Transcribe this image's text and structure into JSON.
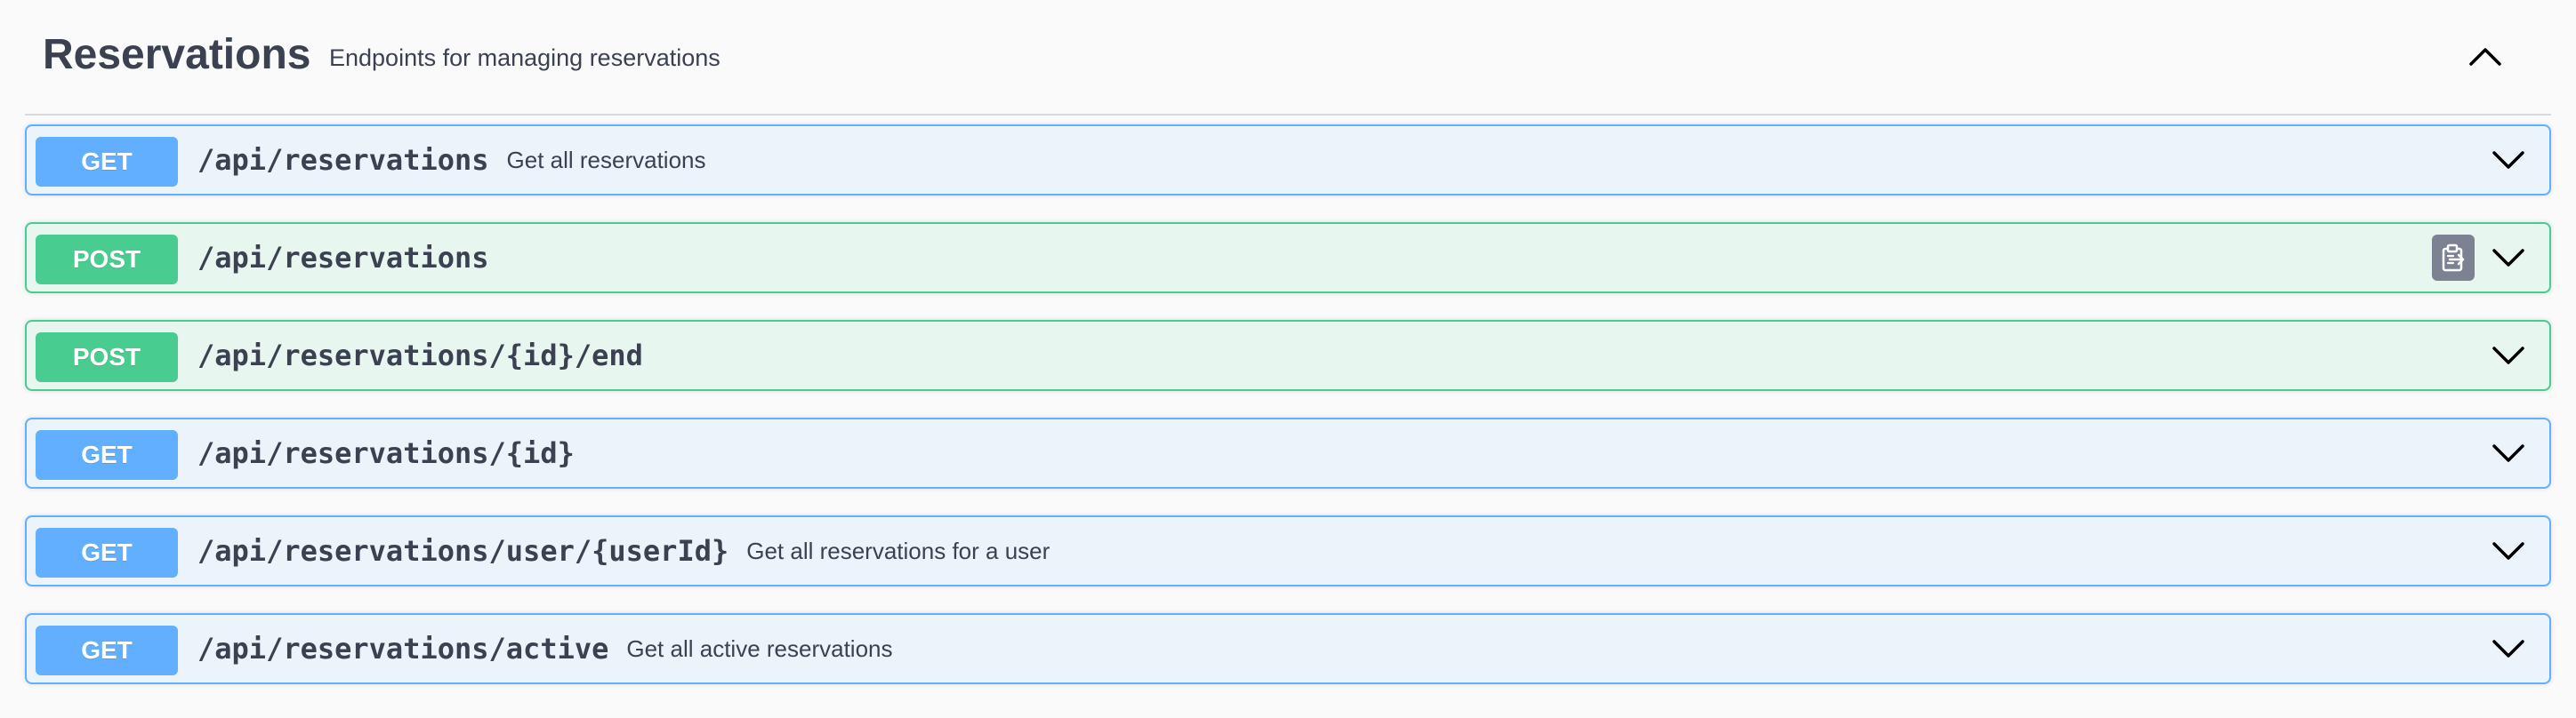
{
  "tag": {
    "title": "Reservations",
    "description": "Endpoints for managing reservations",
    "collapse_icon": "chevron-up-icon"
  },
  "operations": [
    {
      "method": "GET",
      "path": "/api/reservations",
      "summary": "Get all reservations"
    },
    {
      "method": "POST",
      "path": "/api/reservations",
      "summary": "",
      "has_copy": true
    },
    {
      "method": "POST",
      "path": "/api/reservations/{id}/end",
      "summary": ""
    },
    {
      "method": "GET",
      "path": "/api/reservations/{id}",
      "summary": ""
    },
    {
      "method": "GET",
      "path": "/api/reservations/user/{userId}",
      "summary": "Get all reservations for a user"
    },
    {
      "method": "GET",
      "path": "/api/reservations/active",
      "summary": "Get all active reservations"
    }
  ],
  "colors": {
    "get": "#61affe",
    "post": "#49cc90",
    "get_bg": "#ebf3fb",
    "post_bg": "#e8f6f0",
    "text": "#3b4151"
  },
  "icons": {
    "expand": "chevron-down-icon",
    "copy": "copy-to-clipboard-icon"
  }
}
